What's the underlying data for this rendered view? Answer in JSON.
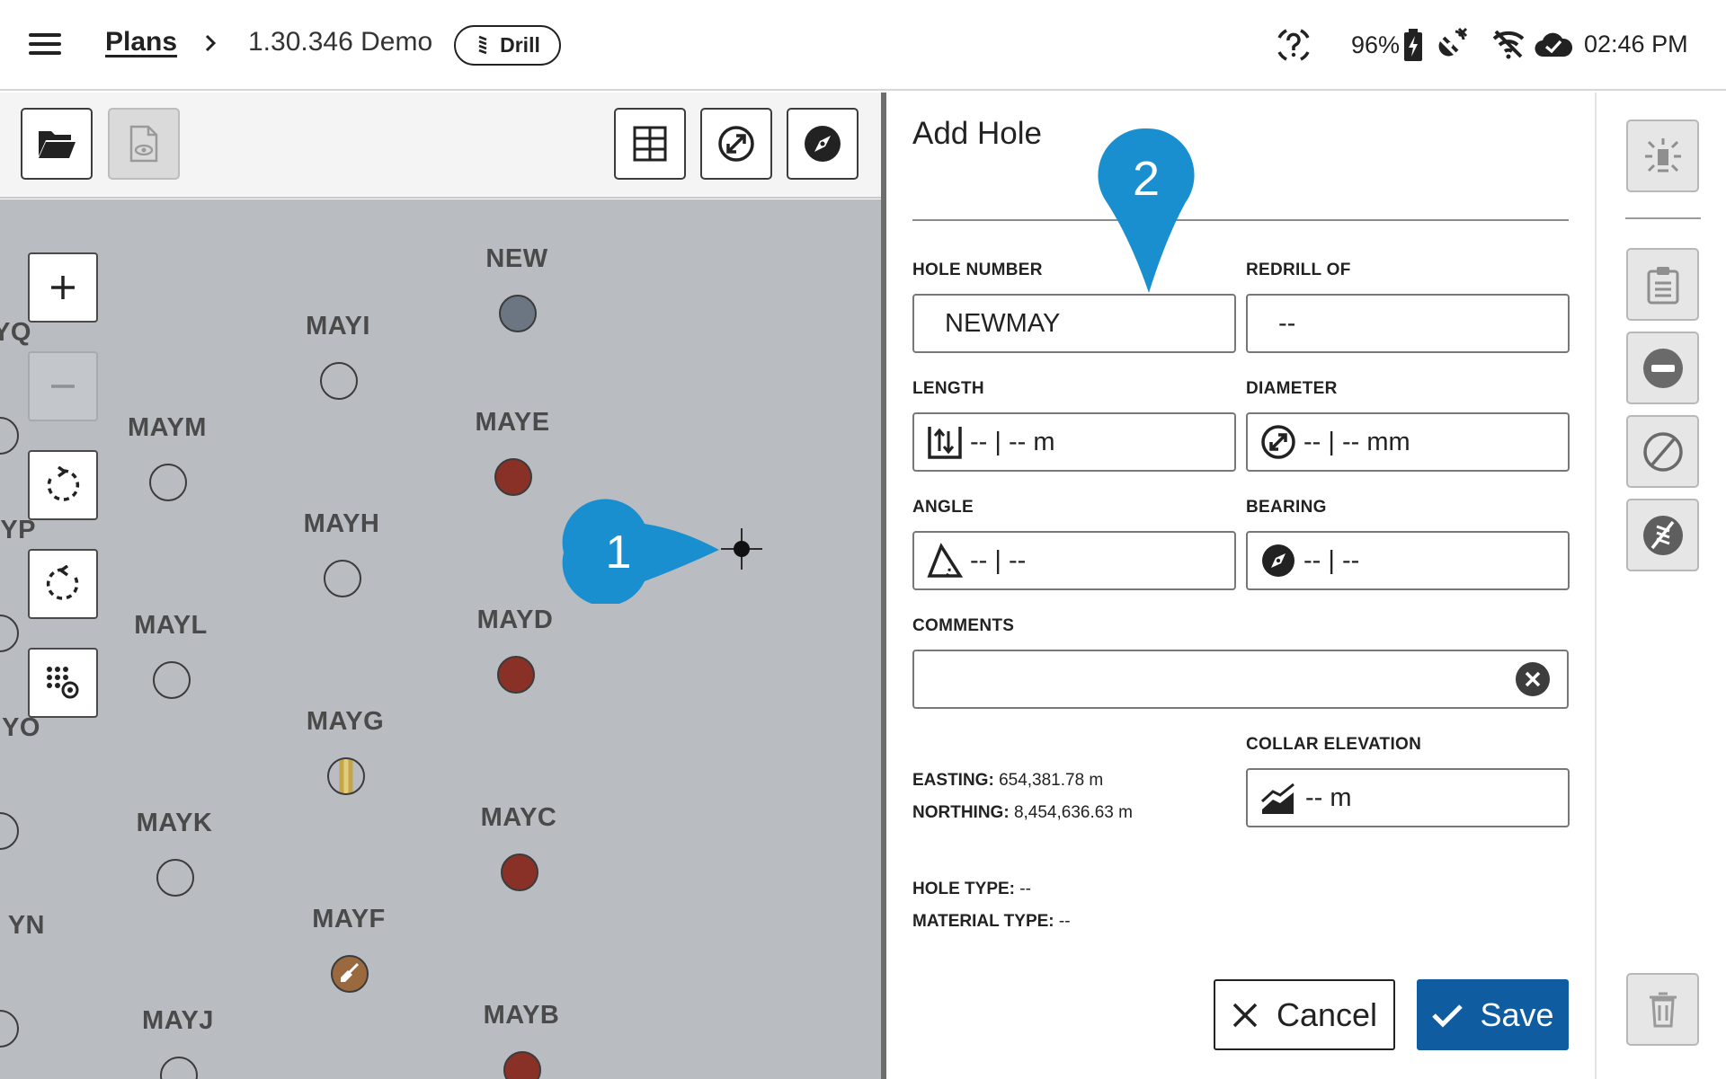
{
  "header": {
    "breadcrumb_plans": "Plans",
    "breadcrumb_current": "1.30.346 Demo",
    "mode_badge": "Drill",
    "battery": "96%",
    "time": "02:46 PM"
  },
  "icons": {
    "menu": "hamburger-menu-icon",
    "help": "help-icon",
    "battery": "battery-charging-icon",
    "gps": "satellite-icon",
    "wifi": "wifi-off-icon",
    "cloud": "cloud-synced-icon"
  },
  "map": {
    "holes": [
      {
        "label": "NEW",
        "state": "new"
      },
      {
        "label": "MAYI",
        "state": "empty"
      },
      {
        "label": "MAYE",
        "state": "drilled"
      },
      {
        "label": "MAYM",
        "state": "empty"
      },
      {
        "label": "MAYH",
        "state": "empty"
      },
      {
        "label": "MAYD",
        "state": "drilled"
      },
      {
        "label": "MAYL",
        "state": "empty"
      },
      {
        "label": "MAYG",
        "state": "striped"
      },
      {
        "label": "MAYC",
        "state": "drilled"
      },
      {
        "label": "MAYK",
        "state": "empty"
      },
      {
        "label": "MAYF",
        "state": "shovel"
      },
      {
        "label": "MAYB",
        "state": "drilled"
      },
      {
        "label": "MAYJ",
        "state": "empty"
      },
      {
        "label": "YQ",
        "state": "empty"
      },
      {
        "label": "YP",
        "state": "empty"
      },
      {
        "label": "YO",
        "state": "empty"
      },
      {
        "label": "YN",
        "state": "empty"
      }
    ],
    "callout_1": "1",
    "callout_2": "2",
    "callout_color": "#1a8fd0",
    "drilled_color": "#8a3127"
  },
  "form": {
    "title": "Add Hole",
    "hole_number_label": "HOLE NUMBER",
    "hole_number_value": "NEWMAY",
    "redrill_label": "REDRILL OF",
    "redrill_value": "--",
    "length_label": "LENGTH",
    "length_value": "-- | -- m",
    "diameter_label": "DIAMETER",
    "diameter_value": "-- | -- mm",
    "angle_label": "ANGLE",
    "angle_value": "-- | --",
    "bearing_label": "BEARING",
    "bearing_value": "-- | --",
    "comments_label": "COMMENTS",
    "comments_value": "",
    "collar_label": "COLLAR ELEVATION",
    "collar_value": "-- m",
    "easting_label": "EASTING:",
    "easting_value": "654,381.78 m",
    "northing_label": "NORTHING:",
    "northing_value": "8,454,636.63 m",
    "hole_type_label": "HOLE TYPE:",
    "hole_type_value": "--",
    "material_type_label": "MATERIAL TYPE:",
    "material_type_value": "--",
    "cancel_label": "Cancel",
    "save_label": "Save",
    "save_color": "#0f5ca0"
  }
}
